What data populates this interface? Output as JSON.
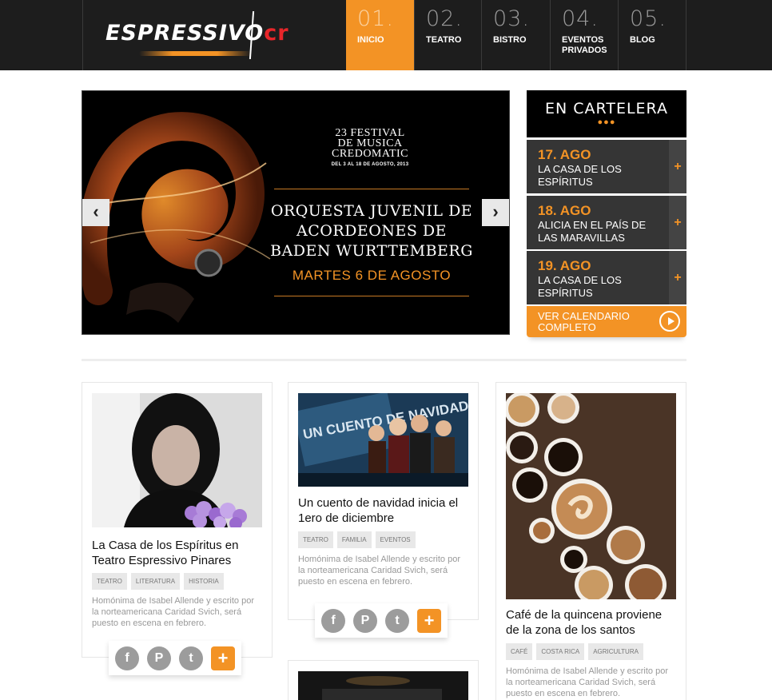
{
  "header": {
    "logo_main": "ESPRESSIVO",
    "logo_suffix": "cr",
    "nav": [
      {
        "num": "01.",
        "label": "INICIO",
        "active": true
      },
      {
        "num": "02.",
        "label": "TEATRO"
      },
      {
        "num": "03.",
        "label": "BISTRO"
      },
      {
        "num": "04.",
        "label": "EVENTOS\nPRIVADOS"
      },
      {
        "num": "05.",
        "label": "BLOG"
      }
    ]
  },
  "hero": {
    "festival_title": "23 FESTIVAL\nDE MUSICA\nCREDOMATIC",
    "festival_dates": "DEL 3 AL 18 DE AGOSTO, 2013",
    "title": "ORQUESTA JUVENIL DE ACORDEONES DE BADEN WURTTEMBERG",
    "date": "MARTES 6 DE AGOSTO",
    "prev": "‹",
    "next": "›"
  },
  "sidebar": {
    "title": "EN CARTELERA",
    "dots": "●●●",
    "events": [
      {
        "date": "17. AGO",
        "name": "LA CASA DE LOS ESPÍRITUS"
      },
      {
        "date": "18. AGO",
        "name": "ALICIA EN EL PAÍS DE LAS MARAVILLAS"
      },
      {
        "date": "19. AGO",
        "name": "LA CASA DE LOS ESPÍRITUS"
      }
    ],
    "plus": "+",
    "calendar_button": "VER CALENDARIO COMPLETO"
  },
  "cards": [
    {
      "title": "La Casa de los Espíritus en Teatro Espressivo Pinares",
      "tags": [
        "TEATRO",
        "LITERATURA",
        "HISTORIA"
      ],
      "desc": "Homónima de Isabel Allende y escrito por la norteamericana Caridad Svich, será puesto en escena en febrero."
    },
    {
      "title": "Un cuento de navidad inicia el 1ero de diciembre",
      "tags": [
        "TEATRO",
        "FAMILIA",
        "EVENTOS"
      ],
      "desc": "Homónima de Isabel Allende y escrito por la norteamericana Caridad Svich, será puesto en escena en febrero.",
      "image_text": "UN CUENTO DE NAVIDAD"
    },
    {
      "title": "Café de la quincena proviene de la zona de los santos",
      "tags": [
        "CAFÉ",
        "COSTA RICA",
        "AGRICULTURA"
      ],
      "desc": "Homónima de Isabel Allende y escrito por la norteamericana Caridad Svich, será puesto en escena en febrero."
    }
  ],
  "share": {
    "facebook": "f",
    "pinterest": "P",
    "twitter": "t",
    "more": "+"
  },
  "colors": {
    "accent": "#f39325",
    "header_bg": "#1d1d1d",
    "event_bg": "#353535"
  }
}
